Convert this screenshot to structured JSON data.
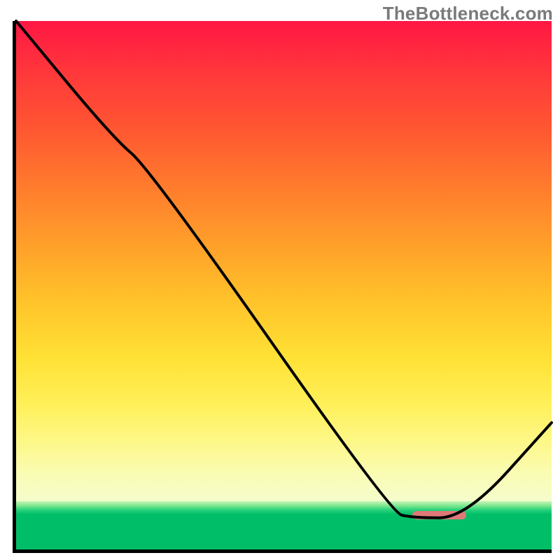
{
  "watermark": "TheBottleneck.com",
  "colors": {
    "axis": "#000000",
    "curve": "#000000",
    "marker": "#e07878",
    "top_gradient_start": "#ff1744",
    "mid_yellow": "#ffe135",
    "green_band": "#07c06a",
    "green_solid": "#00be68"
  },
  "chart_data": {
    "type": "line",
    "title": "",
    "xlabel": "",
    "ylabel": "",
    "xlim": [
      0,
      100
    ],
    "ylim": [
      0,
      100
    ],
    "x": [
      0,
      18,
      25,
      70,
      74,
      84,
      100
    ],
    "values": [
      100,
      78,
      72,
      7,
      6,
      6,
      24
    ],
    "marker_segment": {
      "x_start": 74,
      "x_end": 84,
      "y": 6.5
    },
    "curve_notes": "steep near-linear descent with slight inflection around x≈22, flat valley 74–84, rise to 100"
  }
}
